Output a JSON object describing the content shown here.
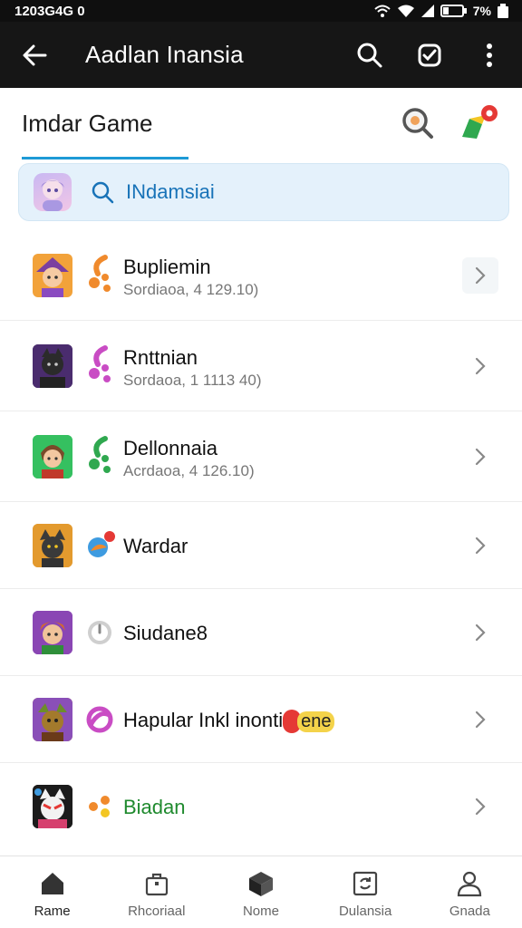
{
  "status_bar": {
    "time": "1203G4G 0",
    "battery": "7%"
  },
  "app_bar": {
    "title": "Aadlan Inansia"
  },
  "section": {
    "title": "Imdar Game"
  },
  "search": {
    "value": "INdamsiai"
  },
  "rows": [
    {
      "name": "Bupliemin",
      "subtitle": "Sordiaoa, 4 129.10)"
    },
    {
      "name": "Rnttnian",
      "subtitle": "Sordaoa, 1 1113 40)"
    },
    {
      "name": "Dellonnaia",
      "subtitle": "Acrdaoa, 4 126.10)"
    },
    {
      "name": "Wardar"
    },
    {
      "name": "Siudane8"
    },
    {
      "name": "Hapular Inkl inonti",
      "tag": "ene"
    },
    {
      "name": "Biadan"
    }
  ],
  "bottom_nav": [
    {
      "label": "Rame",
      "icon": "home-icon",
      "active": true
    },
    {
      "label": "Rhcoriaal",
      "icon": "bag-icon"
    },
    {
      "label": "Nome",
      "icon": "cube-icon"
    },
    {
      "label": "Dulansia",
      "icon": "refresh-frame-icon"
    },
    {
      "label": "Gnada",
      "icon": "person-icon"
    }
  ],
  "colors": {
    "accent": "#1e9ad6",
    "app_bar": "#161616",
    "search_bg": "#e4f1fb",
    "name_green": "#1f8a2e"
  }
}
